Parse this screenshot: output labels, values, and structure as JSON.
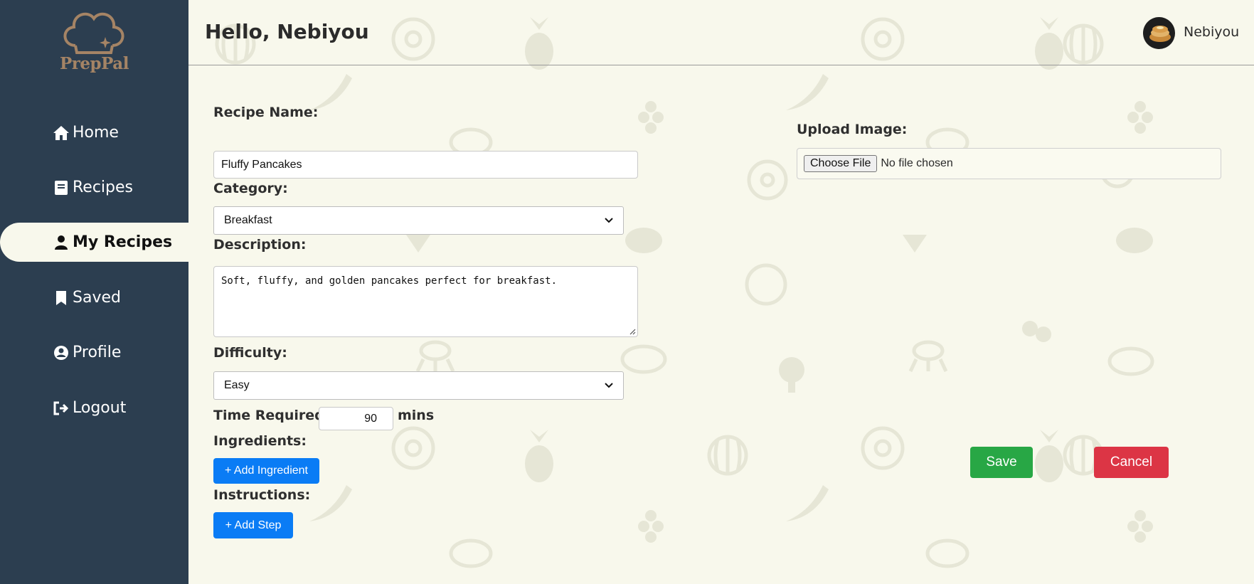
{
  "brand": {
    "name": "PrepPal",
    "color": "#a58465"
  },
  "sidebar": {
    "items": [
      {
        "label": "Home",
        "icon": "home-icon"
      },
      {
        "label": "Recipes",
        "icon": "book-icon"
      },
      {
        "label": "My Recipes",
        "icon": "user-icon",
        "active": true
      },
      {
        "label": "Saved",
        "icon": "bookmark-icon"
      },
      {
        "label": "Profile",
        "icon": "user-circle-icon"
      },
      {
        "label": "Logout",
        "icon": "logout-icon"
      }
    ]
  },
  "header": {
    "greeting": "Hello, Nebiyou",
    "username": "Nebiyou"
  },
  "form": {
    "recipe_name_label": "Recipe Name:",
    "recipe_name_value": "Fluffy Pancakes",
    "category_label": "Category:",
    "category_value": "Breakfast",
    "description_label": "Description:",
    "description_value": "Soft, fluffy, and golden pancakes perfect for breakfast.",
    "difficulty_label": "Difficulty:",
    "difficulty_value": "Easy",
    "time_label": "Time Required:",
    "time_value": "90",
    "time_unit": "mins",
    "ingredients_label": "Ingredients:",
    "add_ingredient_label": "+ Add Ingredient",
    "instructions_label": "Instructions:",
    "add_step_label": "+ Add Step",
    "upload_label": "Upload Image:",
    "choose_file_label": "Choose File",
    "no_file_text": "No file chosen",
    "save_label": "Save",
    "cancel_label": "Cancel"
  },
  "colors": {
    "sidebar_bg": "#2c3e50",
    "page_bg": "#f8f8ec",
    "primary": "#0a7cf5",
    "save": "#28a745",
    "cancel": "#dc3545"
  }
}
